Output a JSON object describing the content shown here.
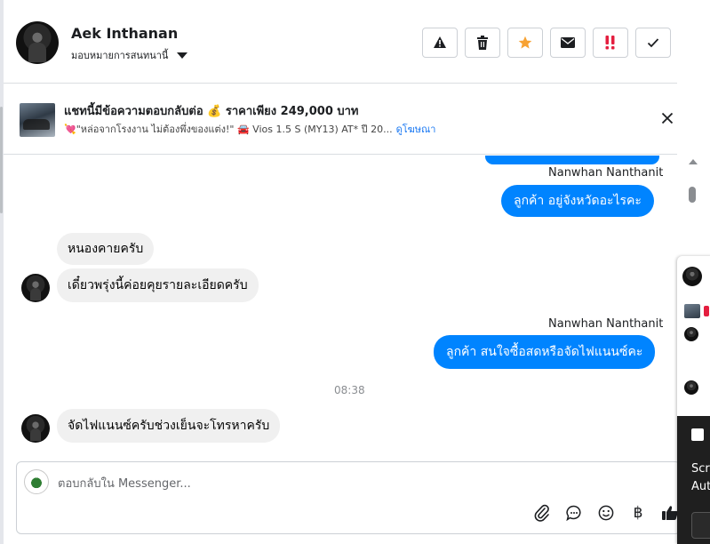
{
  "header": {
    "contact_name": "Aek Inthanan",
    "assign_label": "มอบหมายการสนทนานี้",
    "actions": [
      {
        "name": "report-button",
        "icon": "warning-icon"
      },
      {
        "name": "delete-button",
        "icon": "trash-icon"
      },
      {
        "name": "star-button",
        "icon": "star-icon"
      },
      {
        "name": "mark-unread-button",
        "icon": "envelope-icon"
      },
      {
        "name": "follow-up-button",
        "icon": "exclamation-icon"
      },
      {
        "name": "mark-done-button",
        "icon": "check-icon"
      }
    ]
  },
  "ad": {
    "title": "แชทนี้มีข้อความตอบกลับต่อ 💰 ราคาเพียง 249,000 บาท",
    "subtitle": "💘\"หล่อจากโรงงาน ไม่ต้องพึ่งของแต่ง!\" 🚘 Vios 1.5 S (MY13) AT* ปี 20...",
    "link": "ดูโฆษณา"
  },
  "messages": {
    "sender_1": "Nanwhan Nanthanit",
    "out_1": "ลูกค้า อยู่จังหวัดอะไรคะ",
    "in_1": "หนองคายครับ",
    "in_2": "เดี๋ยวพรุ่งนี้ค่อยคุยรายละเอียดครับ",
    "sender_2": "Nanwhan Nanthanit",
    "out_2": "ลูกค้า สนใจซื้อสดหรือจัดไฟแนนซ์คะ",
    "time": "08:38",
    "in_3": "จัดไฟแนนซ์ครับช่วงเย็นจะโทรหาครับ"
  },
  "composer": {
    "placeholder": "ตอบกลับใน Messenger...",
    "currency_symbol": "฿"
  },
  "overlay": {
    "text_1": "Scre",
    "text_2": "Aut"
  },
  "colors": {
    "outgoing_bubble": "#0084ff",
    "incoming_bubble": "#f0f0f0",
    "link": "#1877f2",
    "star": "#f7a233",
    "alert_red": "#e41e3f"
  }
}
